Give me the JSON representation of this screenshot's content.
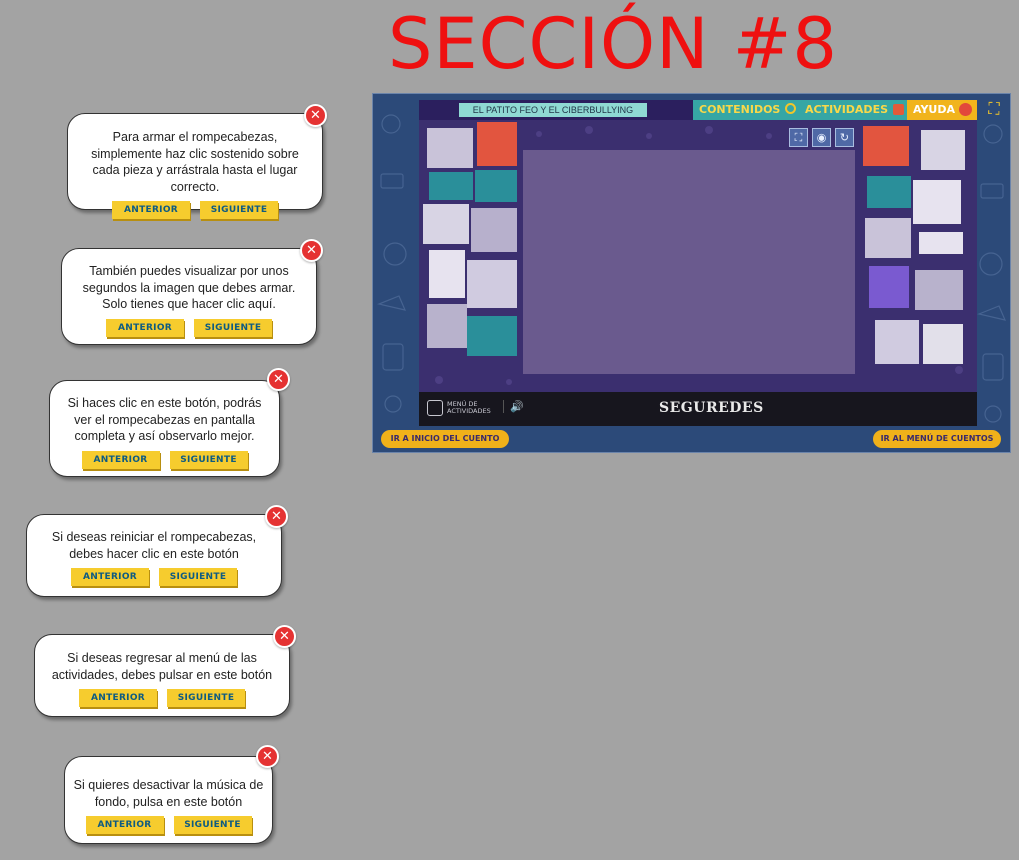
{
  "page": {
    "section_title": "SECCIÓN #8"
  },
  "tooltips": [
    {
      "text": "Para armar el rompecabezas, simplemente haz clic sostenido sobre cada pieza y arrástrala hasta el lugar correcto.",
      "prev_label": "ANTERIOR",
      "next_label": "SIGUIENTE",
      "close_glyph": "✕"
    },
    {
      "text": "También puedes visualizar por unos segundos la imagen que debes armar. Solo tienes que hacer clic aquí.",
      "prev_label": "ANTERIOR",
      "next_label": "SIGUIENTE",
      "close_glyph": "✕"
    },
    {
      "text": "Si haces clic en este botón, podrás ver el rompecabezas en pantalla completa y así observarlo mejor.",
      "prev_label": "ANTERIOR",
      "next_label": "SIGUIENTE",
      "close_glyph": "✕"
    },
    {
      "text": "Si deseas reiniciar el rompecabezas, debes hacer clic en este botón",
      "prev_label": "ANTERIOR",
      "next_label": "SIGUIENTE",
      "close_glyph": "✕"
    },
    {
      "text": "Si deseas regresar al menú de las actividades, debes pulsar en este botón",
      "prev_label": "ANTERIOR",
      "next_label": "SIGUIENTE",
      "close_glyph": "✕"
    },
    {
      "text": "Si quieres desactivar la música de fondo, pulsa en este botón",
      "prev_label": "ANTERIOR",
      "next_label": "SIGUIENTE",
      "close_glyph": "✕"
    }
  ],
  "game": {
    "story_title": "EL PATITO FEO Y EL CIBERBULLYING",
    "nav": {
      "contenidos": "CONTENIDOS",
      "actividades": "ACTIVIDADES",
      "ayuda": "AYUDA"
    },
    "controls": {
      "fullscreen_icon": "⛶",
      "preview_icon": "◉",
      "reset_icon": "↻",
      "corner_fullscreen_icon": "⛶"
    },
    "bottom": {
      "menu_line1": "MENÚ DE",
      "menu_line2": "ACTIVIDADES",
      "sound_icon": "🔊",
      "brand": "SEGUREDES"
    },
    "footer": {
      "back_story": "IR A INICIO DEL CUENTO",
      "stories_menu": "IR AL MENÚ DE CUENTOS"
    },
    "colors": {
      "frame_blue": "#2c4a79",
      "board_purple": "#3b2f6f",
      "nav_teal": "#36a6a5",
      "accent_yellow": "#f1b41c"
    }
  }
}
